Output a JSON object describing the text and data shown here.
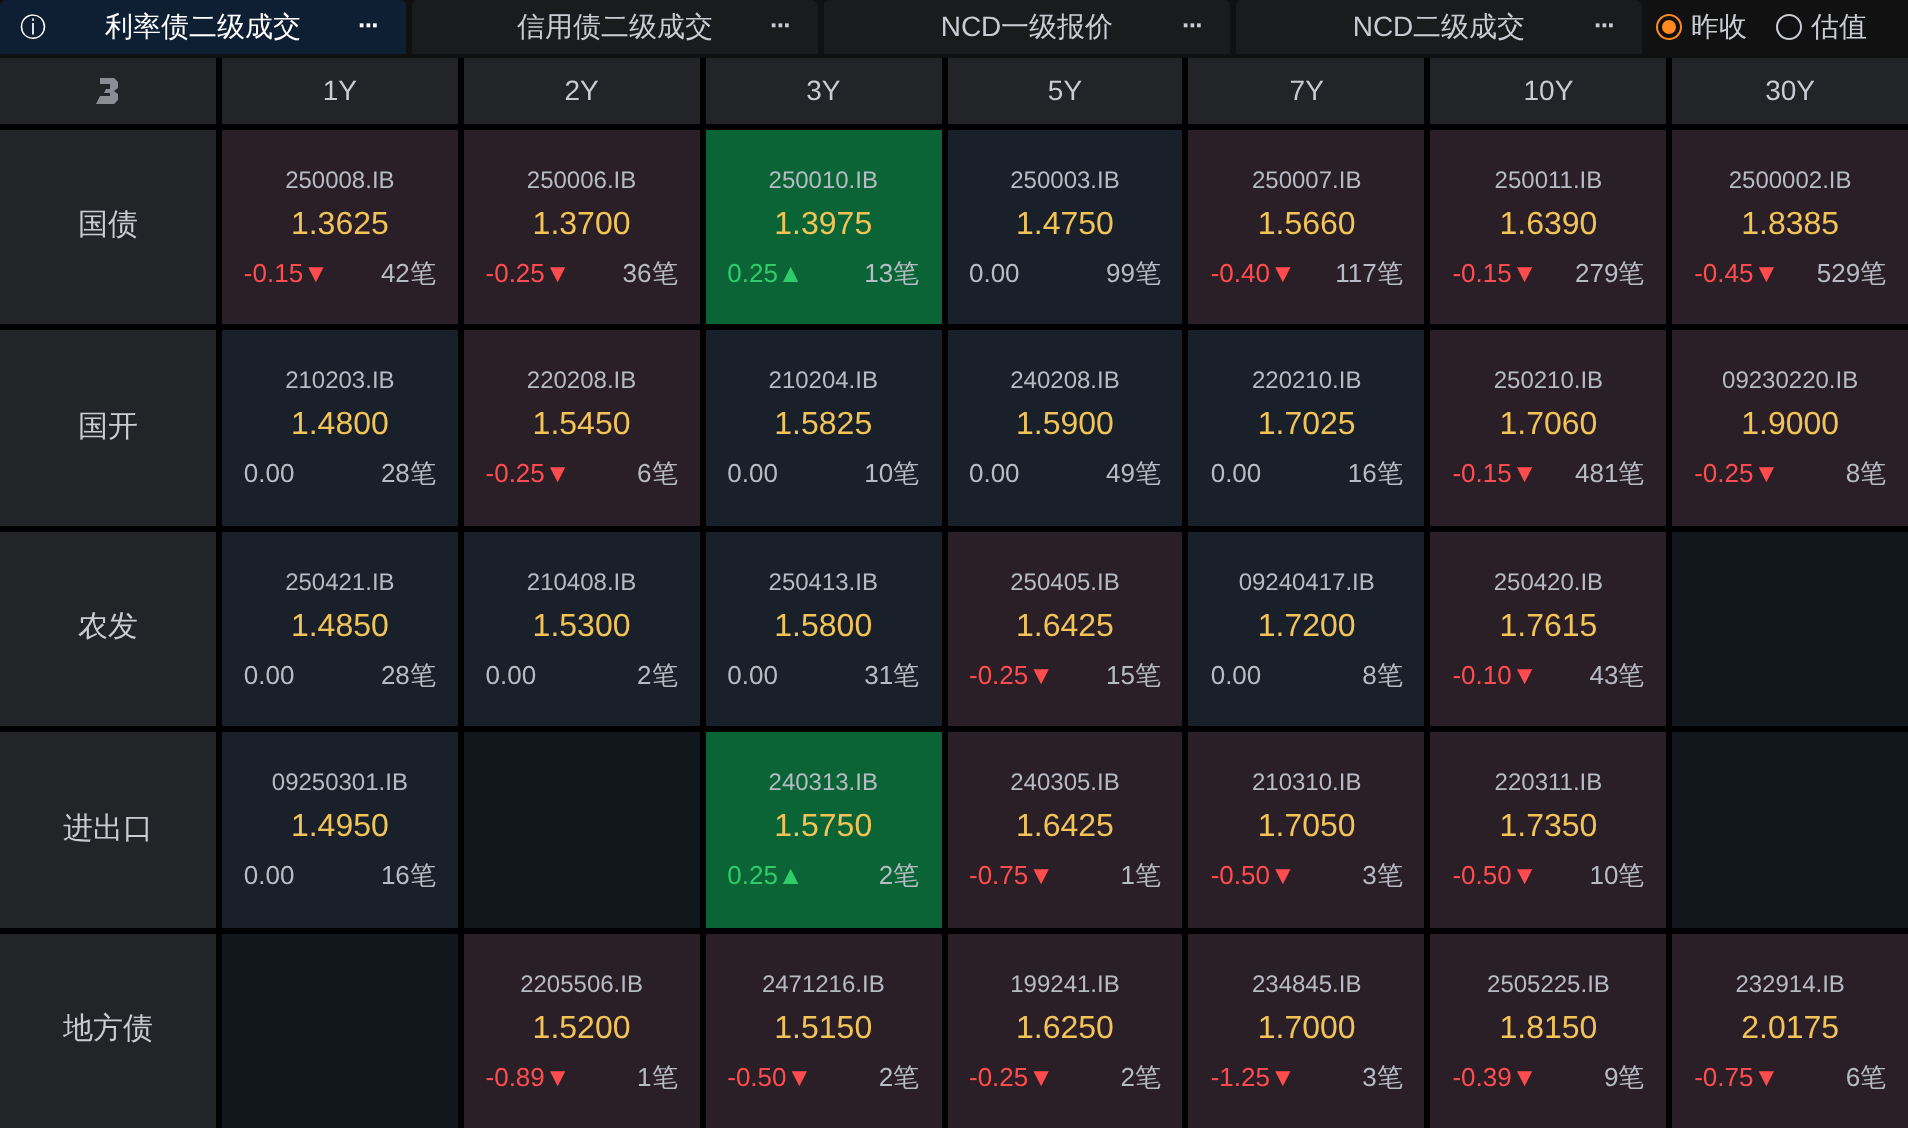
{
  "tabs": [
    {
      "label": "利率债二级成交",
      "selected": true,
      "more": "···",
      "info": "ⓘ"
    },
    {
      "label": "信用债二级成交",
      "selected": false,
      "more": "···"
    },
    {
      "label": "NCD一级报价",
      "selected": false,
      "more": "···"
    },
    {
      "label": "NCD二级成交",
      "selected": false,
      "more": "···"
    }
  ],
  "radios": [
    {
      "label": "昨收",
      "selected": true
    },
    {
      "label": "估值",
      "selected": false
    }
  ],
  "columns": [
    "1Y",
    "2Y",
    "3Y",
    "5Y",
    "7Y",
    "10Y",
    "30Y"
  ],
  "rows": [
    {
      "label": "国债",
      "cells": [
        {
          "kind": "down",
          "code": "250008.IB",
          "yield": "1.3625",
          "change": "-0.15▼",
          "count": "42笔"
        },
        {
          "kind": "down",
          "code": "250006.IB",
          "yield": "1.3700",
          "change": "-0.25▼",
          "count": "36笔"
        },
        {
          "kind": "up",
          "code": "250010.IB",
          "yield": "1.3975",
          "change": "0.25▲",
          "count": "13笔"
        },
        {
          "kind": "flat",
          "code": "250003.IB",
          "yield": "1.4750",
          "change": "0.00",
          "count": "99笔"
        },
        {
          "kind": "down",
          "code": "250007.IB",
          "yield": "1.5660",
          "change": "-0.40▼",
          "count": "117笔"
        },
        {
          "kind": "down",
          "code": "250011.IB",
          "yield": "1.6390",
          "change": "-0.15▼",
          "count": "279笔"
        },
        {
          "kind": "down",
          "code": "2500002.IB",
          "yield": "1.8385",
          "change": "-0.45▼",
          "count": "529笔"
        }
      ]
    },
    {
      "label": "国开",
      "cells": [
        {
          "kind": "flat",
          "code": "210203.IB",
          "yield": "1.4800",
          "change": "0.00",
          "count": "28笔"
        },
        {
          "kind": "down",
          "code": "220208.IB",
          "yield": "1.5450",
          "change": "-0.25▼",
          "count": "6笔"
        },
        {
          "kind": "flat",
          "code": "210204.IB",
          "yield": "1.5825",
          "change": "0.00",
          "count": "10笔"
        },
        {
          "kind": "flat",
          "code": "240208.IB",
          "yield": "1.5900",
          "change": "0.00",
          "count": "49笔"
        },
        {
          "kind": "flat",
          "code": "220210.IB",
          "yield": "1.7025",
          "change": "0.00",
          "count": "16笔"
        },
        {
          "kind": "down",
          "code": "250210.IB",
          "yield": "1.7060",
          "change": "-0.15▼",
          "count": "481笔"
        },
        {
          "kind": "down",
          "code": "09230220.IB",
          "yield": "1.9000",
          "change": "-0.25▼",
          "count": "8笔"
        }
      ]
    },
    {
      "label": "农发",
      "cells": [
        {
          "kind": "flat",
          "code": "250421.IB",
          "yield": "1.4850",
          "change": "0.00",
          "count": "28笔"
        },
        {
          "kind": "flat",
          "code": "210408.IB",
          "yield": "1.5300",
          "change": "0.00",
          "count": "2笔"
        },
        {
          "kind": "flat",
          "code": "250413.IB",
          "yield": "1.5800",
          "change": "0.00",
          "count": "31笔"
        },
        {
          "kind": "down",
          "code": "250405.IB",
          "yield": "1.6425",
          "change": "-0.25▼",
          "count": "15笔"
        },
        {
          "kind": "flat",
          "code": "09240417.IB",
          "yield": "1.7200",
          "change": "0.00",
          "count": "8笔"
        },
        {
          "kind": "down",
          "code": "250420.IB",
          "yield": "1.7615",
          "change": "-0.10▼",
          "count": "43笔"
        },
        {
          "kind": "empty"
        }
      ]
    },
    {
      "label": "进出口",
      "cells": [
        {
          "kind": "flat",
          "code": "09250301.IB",
          "yield": "1.4950",
          "change": "0.00",
          "count": "16笔"
        },
        {
          "kind": "empty"
        },
        {
          "kind": "up",
          "code": "240313.IB",
          "yield": "1.5750",
          "change": "0.25▲",
          "count": "2笔"
        },
        {
          "kind": "down",
          "code": "240305.IB",
          "yield": "1.6425",
          "change": "-0.75▼",
          "count": "1笔"
        },
        {
          "kind": "down",
          "code": "210310.IB",
          "yield": "1.7050",
          "change": "-0.50▼",
          "count": "3笔"
        },
        {
          "kind": "down",
          "code": "220311.IB",
          "yield": "1.7350",
          "change": "-0.50▼",
          "count": "10笔"
        },
        {
          "kind": "empty"
        }
      ]
    },
    {
      "label": "地方债",
      "cells": [
        {
          "kind": "empty"
        },
        {
          "kind": "down",
          "code": "2205506.IB",
          "yield": "1.5200",
          "change": "-0.89▼",
          "count": "1笔"
        },
        {
          "kind": "down",
          "code": "2471216.IB",
          "yield": "1.5150",
          "change": "-0.50▼",
          "count": "2笔"
        },
        {
          "kind": "down",
          "code": "199241.IB",
          "yield": "1.6250",
          "change": "-0.25▼",
          "count": "2笔"
        },
        {
          "kind": "down",
          "code": "234845.IB",
          "yield": "1.7000",
          "change": "-1.25▼",
          "count": "3笔"
        },
        {
          "kind": "down",
          "code": "2505225.IB",
          "yield": "1.8150",
          "change": "-0.39▼",
          "count": "9笔"
        },
        {
          "kind": "down",
          "code": "232914.IB",
          "yield": "2.0175",
          "change": "-0.75▼",
          "count": "6笔"
        }
      ]
    }
  ]
}
